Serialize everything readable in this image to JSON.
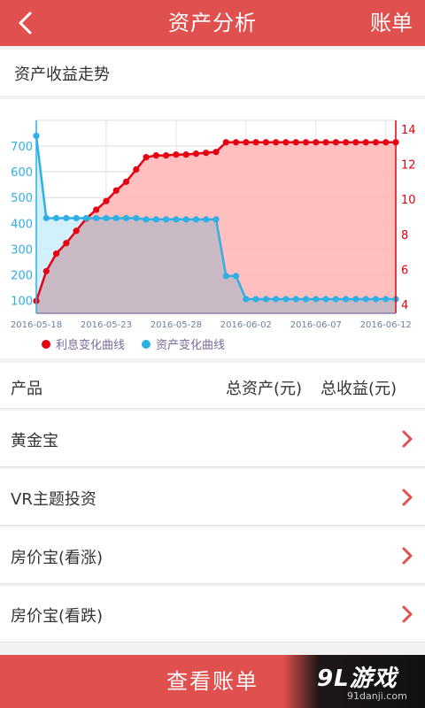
{
  "header": {
    "title": "资产分析",
    "right_action": "账单"
  },
  "section": {
    "title": "资产收益走势"
  },
  "chart_data": {
    "type": "line",
    "x_ticks": [
      "2016-05-18",
      "2016-05-23",
      "2016-05-28",
      "2016-06-02",
      "2016-06-07",
      "2016-06-12"
    ],
    "y_left_ticks": [
      100,
      200,
      300,
      400,
      500,
      600,
      700
    ],
    "y_right_ticks": [
      4,
      6,
      8,
      10,
      12,
      14
    ],
    "y_left_range": [
      50,
      800
    ],
    "y_right_range": [
      3.5,
      14.5
    ],
    "grid": true,
    "legend_position": "bottom-left",
    "series": [
      {
        "name": "利息变化曲线",
        "axis": "right",
        "color": "#e60012",
        "fill": "#ffb8b8",
        "values": [
          4.2,
          5.9,
          6.9,
          7.5,
          8.2,
          8.9,
          9.4,
          9.9,
          10.5,
          11.0,
          11.7,
          12.4,
          12.5,
          12.5,
          12.55,
          12.55,
          12.6,
          12.65,
          12.7,
          13.25,
          13.25,
          13.25,
          13.25,
          13.25,
          13.25,
          13.25,
          13.25,
          13.25,
          13.25,
          13.25,
          13.25,
          13.25,
          13.25,
          13.25,
          13.25,
          13.25,
          13.25
        ]
      },
      {
        "name": "资产变化曲线",
        "axis": "left",
        "color": "#2eb0e4",
        "fill": "#cbeefb",
        "values": [
          740,
          420,
          420,
          420,
          420,
          420,
          420,
          420,
          420,
          420,
          420,
          415,
          415,
          415,
          415,
          415,
          415,
          415,
          415,
          195,
          195,
          105,
          105,
          105,
          105,
          105,
          105,
          105,
          105,
          105,
          105,
          105,
          105,
          105,
          105,
          105,
          105
        ]
      }
    ]
  },
  "table": {
    "col_product": "产品",
    "col_total_assets": "总资产(元)",
    "col_total_income": "总收益(元)",
    "rows": [
      {
        "name": "黄金宝"
      },
      {
        "name": "VR主题投资"
      },
      {
        "name": "房价宝(看涨)"
      },
      {
        "name": "房价宝(看跌)"
      }
    ]
  },
  "footer": {
    "button_label": "查看账单"
  },
  "watermark": {
    "logo": "9L游戏",
    "url": "91danji.com"
  },
  "colors": {
    "primary": "#e0504f",
    "interest_line": "#e60012",
    "asset_line": "#2eb0e4"
  }
}
